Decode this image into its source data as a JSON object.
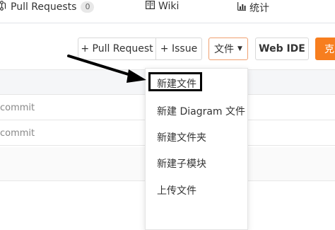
{
  "tabs": {
    "pull_requests": {
      "label": "Pull Requests",
      "count": "0",
      "icon": "pull-request-icon"
    },
    "wiki": {
      "label": "Wiki",
      "icon": "book-icon"
    },
    "stats": {
      "label": "统计",
      "icon": "bar-chart-icon"
    }
  },
  "toolbar": {
    "pull_request_label": "+ Pull Request",
    "issue_label": "+ Issue",
    "file_label": "文件",
    "web_ide_label": "Web IDE",
    "clone_label": "克"
  },
  "rows": [
    {
      "text": "commit"
    },
    {
      "text": "commit"
    }
  ],
  "file_menu": {
    "items": [
      {
        "label": "新建文件"
      },
      {
        "label": "新建 Diagram 文件"
      },
      {
        "label": "新建文件夹"
      },
      {
        "label": "新建子模块"
      },
      {
        "label": "上传文件"
      }
    ]
  },
  "colors": {
    "accent": "#f77e1f",
    "annotation": "#000000",
    "file_button_border": "#f0a070"
  }
}
